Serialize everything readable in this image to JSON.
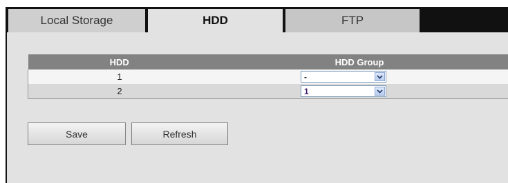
{
  "tabs": [
    {
      "label": "Local Storage"
    },
    {
      "label": "HDD"
    },
    {
      "label": "FTP"
    }
  ],
  "table": {
    "headers": [
      "HDD",
      "HDD Group"
    ],
    "rows": [
      {
        "hdd": "1",
        "group": "-"
      },
      {
        "hdd": "2",
        "group": "1"
      }
    ]
  },
  "buttons": {
    "save": "Save",
    "refresh": "Refresh"
  },
  "icons": {
    "dropdown": "chevron-down-icon"
  },
  "colors": {
    "header_bg": "#828282",
    "active_tab": "#e2e2e2",
    "frame": "#111111"
  }
}
